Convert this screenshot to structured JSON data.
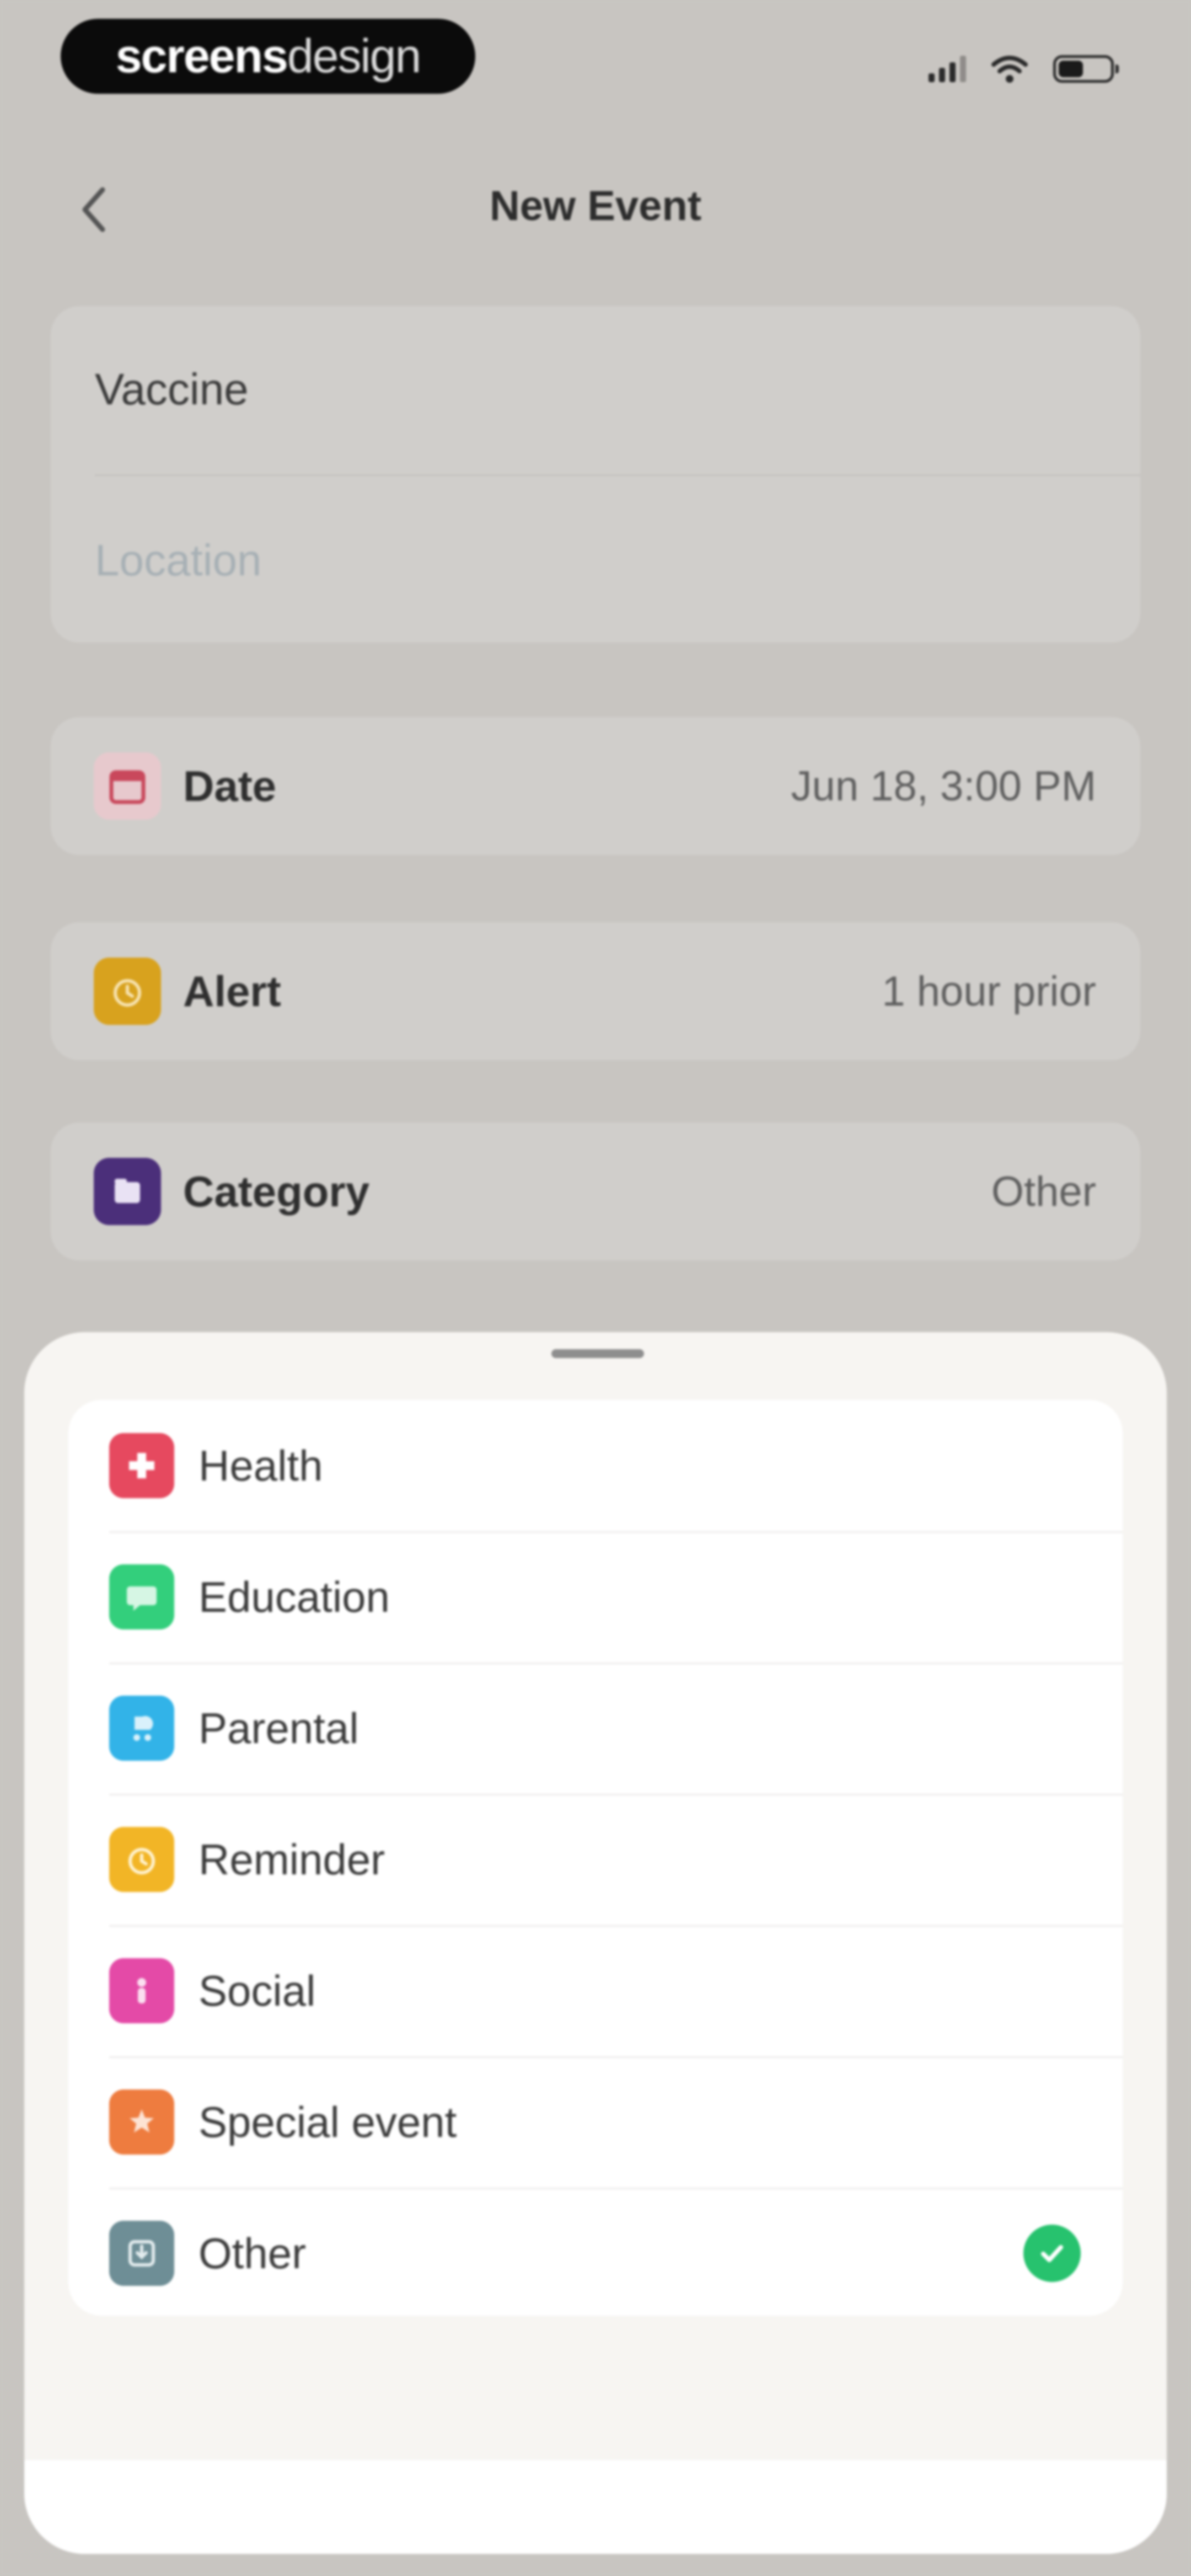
{
  "status_bar": {
    "brand_bold": "screens",
    "brand_light": "design",
    "icons": [
      "signal-icon",
      "wifi-icon",
      "battery-icon"
    ]
  },
  "nav": {
    "back_icon": "chevron-left-icon",
    "title": "New Event"
  },
  "form": {
    "title_value": "Vaccine",
    "location_placeholder": "Location"
  },
  "rows": [
    {
      "icon": "calendar-icon",
      "label": "Date",
      "value": "Jun 18, 3:00 PM",
      "color": "#c9485c"
    },
    {
      "icon": "alarm-icon",
      "label": "Alert",
      "value": "1 hour prior",
      "color": "#d8a21e"
    },
    {
      "icon": "folder-icon",
      "label": "Category",
      "value": "Other",
      "color": "#4b2f7a"
    }
  ],
  "sheet": {
    "categories": [
      {
        "label": "Health",
        "icon": "health-cross-icon",
        "color": "#e6495f",
        "selected": false
      },
      {
        "label": "Education",
        "icon": "chat-bubble-icon",
        "color": "#33cf7c",
        "selected": false
      },
      {
        "label": "Parental",
        "icon": "stroller-icon",
        "color": "#32b3e8",
        "selected": false
      },
      {
        "label": "Reminder",
        "icon": "alarm-icon",
        "color": "#f2b526",
        "selected": false
      },
      {
        "label": "Social",
        "icon": "person-icon",
        "color": "#e44aa7",
        "selected": false
      },
      {
        "label": "Special event",
        "icon": "star-icon",
        "color": "#ee7c3f",
        "selected": false
      },
      {
        "label": "Other",
        "icon": "tray-icon",
        "color": "#6e8e96",
        "selected": true
      }
    ],
    "check_color": "#27c26e"
  }
}
